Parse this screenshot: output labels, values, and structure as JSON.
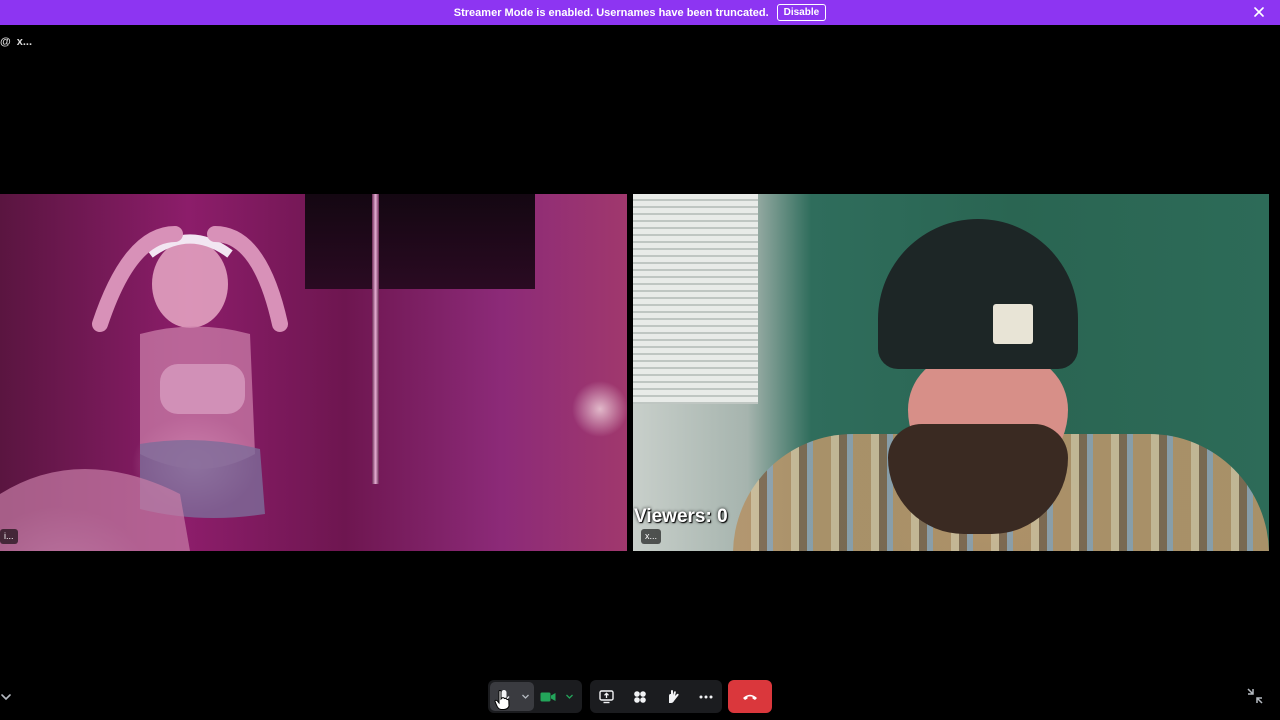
{
  "banner": {
    "message": "Streamer Mode is enabled. Usernames have been truncated.",
    "disable_label": "Disable",
    "close_icon": "close-icon",
    "color": "#8d35f2"
  },
  "channel": {
    "at_symbol": "@",
    "name": "x..."
  },
  "tiles": [
    {
      "name_tag": "i..."
    },
    {
      "name_tag": "x...",
      "overlay_text": "Viewers: 0"
    }
  ],
  "controls": {
    "mic_icon": "microphone-icon",
    "mic_options_icon": "chevron-down-icon",
    "camera_icon": "video-camera-icon",
    "camera_options_icon": "chevron-down-icon",
    "camera_color": "#23a55a",
    "screen_share_icon": "screen-share-icon",
    "activities_icon": "activities-icon",
    "soundboard_icon": "soundboard-icon",
    "more_icon": "more-icon",
    "end_call_icon": "phone-hangup-icon",
    "end_call_color": "#da373c"
  },
  "corner": {
    "collapse_icon": "chevron-down-icon",
    "fullscreen_exit_icon": "exit-fullscreen-icon"
  }
}
